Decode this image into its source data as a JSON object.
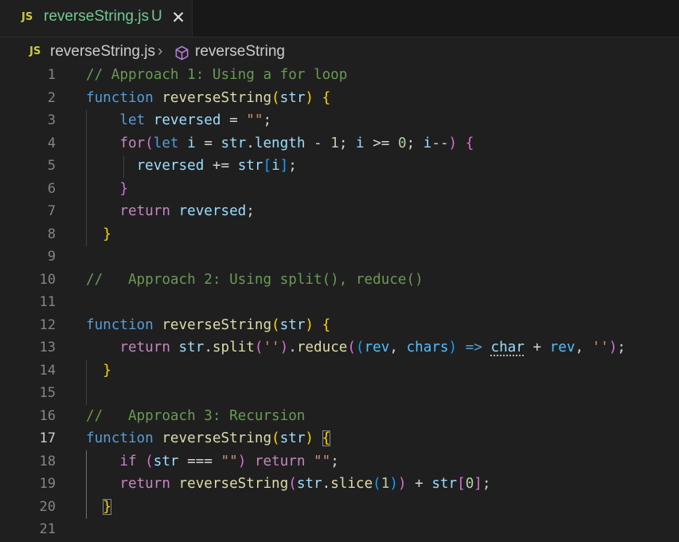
{
  "tab": {
    "lang_icon": "JS",
    "label": "reverseString.js",
    "badge": "U",
    "close_icon": "✕"
  },
  "breadcrumb": {
    "lang_icon": "JS",
    "file": "reverseString.js",
    "separator": "›",
    "symbol_icon": "cube-icon",
    "symbol": "reverseString"
  },
  "editor": {
    "current_line": 17,
    "line_numbers": [
      "1",
      "2",
      "3",
      "4",
      "5",
      "6",
      "7",
      "8",
      "9",
      "10",
      "11",
      "12",
      "13",
      "14",
      "15",
      "16",
      "17",
      "18",
      "19",
      "20",
      "21"
    ],
    "lines": [
      "// Approach 1: Using a for loop",
      "function reverseString(str) {",
      "    let reversed = \"\";",
      "    for(let i = str.length - 1; i >= 0; i--) {",
      "      reversed += str[i];",
      "    }",
      "    return reversed;",
      "  }",
      "",
      "//   Approach 2: Using split(), reduce()",
      "",
      "function reverseString(str) {",
      "    return str.split('').reduce((rev, chars) => char + rev, '');",
      "  }",
      "",
      "//   Approach 3: Recursion",
      "function reverseString(str) {",
      "    if (str === \"\") return \"\";",
      "    return reverseString(str.slice(1)) + str[0];",
      "  }",
      ""
    ]
  },
  "colors": {
    "background": "#1f1f1f",
    "comment": "#6a9955",
    "keyword": "#569cd6",
    "control": "#c586c0",
    "function": "#dcdcaa",
    "variable": "#9cdcfe",
    "string": "#ce9178",
    "number": "#b5cea8",
    "untracked": "#73c991"
  }
}
